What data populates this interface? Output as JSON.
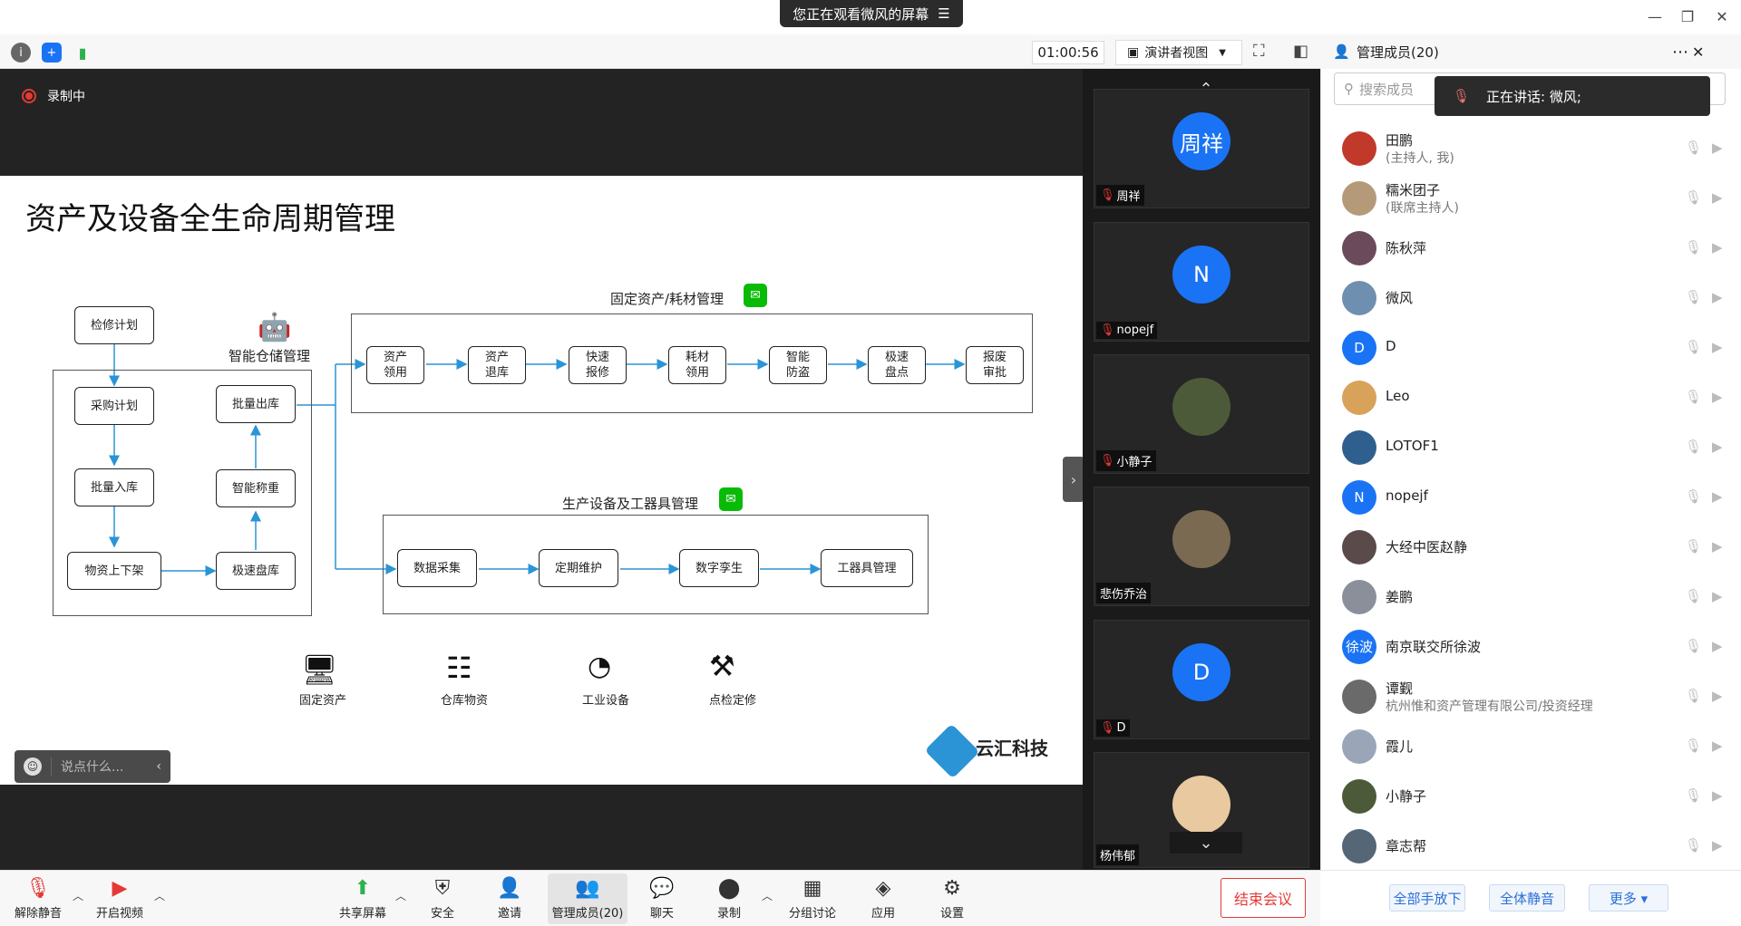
{
  "banner": {
    "sharing_text": "您正在观看微风的屏幕",
    "menu_icon": "menu-icon"
  },
  "toolbar": {
    "timer": "01:00:56",
    "view_label": "演讲者视图"
  },
  "stage": {
    "recording_label": "录制中",
    "slide": {
      "title": "资产及设备全生命周期管理",
      "android_label": "智能仓储管理",
      "left_boxes": [
        "检修计划",
        "采购计划",
        "批量出库",
        "批量入库",
        "智能称重",
        "物资上下架",
        "极速盘库"
      ],
      "fixed_assets_title": "固定资产/耗材管理",
      "fixed_assets_steps": [
        "资产\n领用",
        "资产\n退库",
        "快速\n报修",
        "耗材\n领用",
        "智能\n防盗",
        "极速\n盘点",
        "报废\n审批"
      ],
      "production_title": "生产设备及工器具管理",
      "production_steps": [
        "数据采集",
        "定期维护",
        "数字孪生",
        "工器具管理"
      ],
      "bottom_icons": [
        "固定资产",
        "仓库物资",
        "工业设备",
        "点检定修"
      ],
      "logo_text": "云汇科技"
    },
    "comment_placeholder": "说点什么..."
  },
  "strip": {
    "tiles": [
      {
        "name": "周祥",
        "avatar_text": "周祥",
        "avatar_color": "#1a73f5",
        "muted": true
      },
      {
        "name": "nopejf",
        "avatar_text": "N",
        "avatar_color": "#1a73f5",
        "muted": true
      },
      {
        "name": "小静子",
        "avatar_text": "",
        "avatar_color": "#4c5a3a",
        "muted": true
      },
      {
        "name": "悲伤乔治",
        "avatar_text": "",
        "avatar_color": "#7a6a52",
        "muted": false
      },
      {
        "name": "D",
        "avatar_text": "D",
        "avatar_color": "#1a73f5",
        "muted": true
      },
      {
        "name": "杨伟郁",
        "avatar_text": "",
        "avatar_color": "#e9c9a0",
        "muted": false
      }
    ]
  },
  "panel": {
    "title": "管理成员(20)",
    "search_placeholder": "搜索成员",
    "speaking": "正在讲话: 微风;",
    "members": [
      {
        "name": "田鹏",
        "sub": "(主持人, 我)",
        "avatar_text": "",
        "avatar_color": "#c0392b"
      },
      {
        "name": "糯米团子",
        "sub": "(联席主持人)",
        "avatar_text": "",
        "avatar_color": "#b59a7a"
      },
      {
        "name": "陈秋萍",
        "sub": "",
        "avatar_text": "",
        "avatar_color": "#6b4b5b"
      },
      {
        "name": "微风",
        "sub": "",
        "avatar_text": "",
        "avatar_color": "#6f8fb0"
      },
      {
        "name": "D",
        "sub": "",
        "avatar_text": "D",
        "avatar_color": "#1a73f5"
      },
      {
        "name": "Leo",
        "sub": "",
        "avatar_text": "",
        "avatar_color": "#d9a25a"
      },
      {
        "name": "LOTOF1",
        "sub": "",
        "avatar_text": "",
        "avatar_color": "#2f5f8f"
      },
      {
        "name": "nopejf",
        "sub": "",
        "avatar_text": "N",
        "avatar_color": "#1a73f5"
      },
      {
        "name": "大经中医赵静",
        "sub": "",
        "avatar_text": "",
        "avatar_color": "#5a4a4a"
      },
      {
        "name": "姜鹏",
        "sub": "",
        "avatar_text": "",
        "avatar_color": "#8a8f9a"
      },
      {
        "name": "南京联交所徐波",
        "sub": "",
        "avatar_text": "徐波",
        "avatar_color": "#1a73f5"
      },
      {
        "name": "谭觐",
        "sub": "杭州惟和资产管理有限公司/投资经理",
        "avatar_text": "",
        "avatar_color": "#6a6a6a"
      },
      {
        "name": "霞儿",
        "sub": "",
        "avatar_text": "",
        "avatar_color": "#9aa6b8"
      },
      {
        "name": "小静子",
        "sub": "",
        "avatar_text": "",
        "avatar_color": "#4c5a3a"
      },
      {
        "name": "章志帮",
        "sub": "",
        "avatar_text": "",
        "avatar_color": "#556677"
      }
    ],
    "footer": {
      "raise_down": "全部手放下",
      "mute_all": "全体静音",
      "more": "更多 ▾"
    }
  },
  "bottombar": {
    "unmute": "解除静音",
    "video": "开启视频",
    "share": "共享屏幕",
    "security": "安全",
    "invite": "邀请",
    "members": "管理成员(20)",
    "chat": "聊天",
    "record": "录制",
    "breakout": "分组讨论",
    "apps": "应用",
    "settings": "设置",
    "end": "结束会议"
  },
  "colors": {
    "accent": "#1a73f5",
    "danger": "#e53935",
    "wechat": "#09bb07",
    "flow_line": "#2a94d6"
  }
}
